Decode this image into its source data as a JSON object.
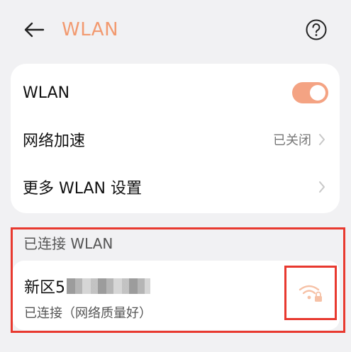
{
  "header": {
    "title": "WLAN",
    "icons": {
      "back": "back-arrow-icon",
      "help": "question-circle-icon"
    }
  },
  "settings": {
    "wlan_label": "WLAN",
    "wlan_enabled": true,
    "accel_label": "网络加速",
    "accel_value": "已关闭",
    "more_label": "更多 WLAN 设置"
  },
  "connected": {
    "section_title": "已连接 WLAN",
    "network_name_visible": "新区5",
    "network_status": "已连接（网络质量好）",
    "signal_icon": "wifi-locked-icon"
  },
  "colors": {
    "accent": "#f29a70",
    "toggle_on": "#f4a383",
    "highlight": "#e8392f"
  }
}
